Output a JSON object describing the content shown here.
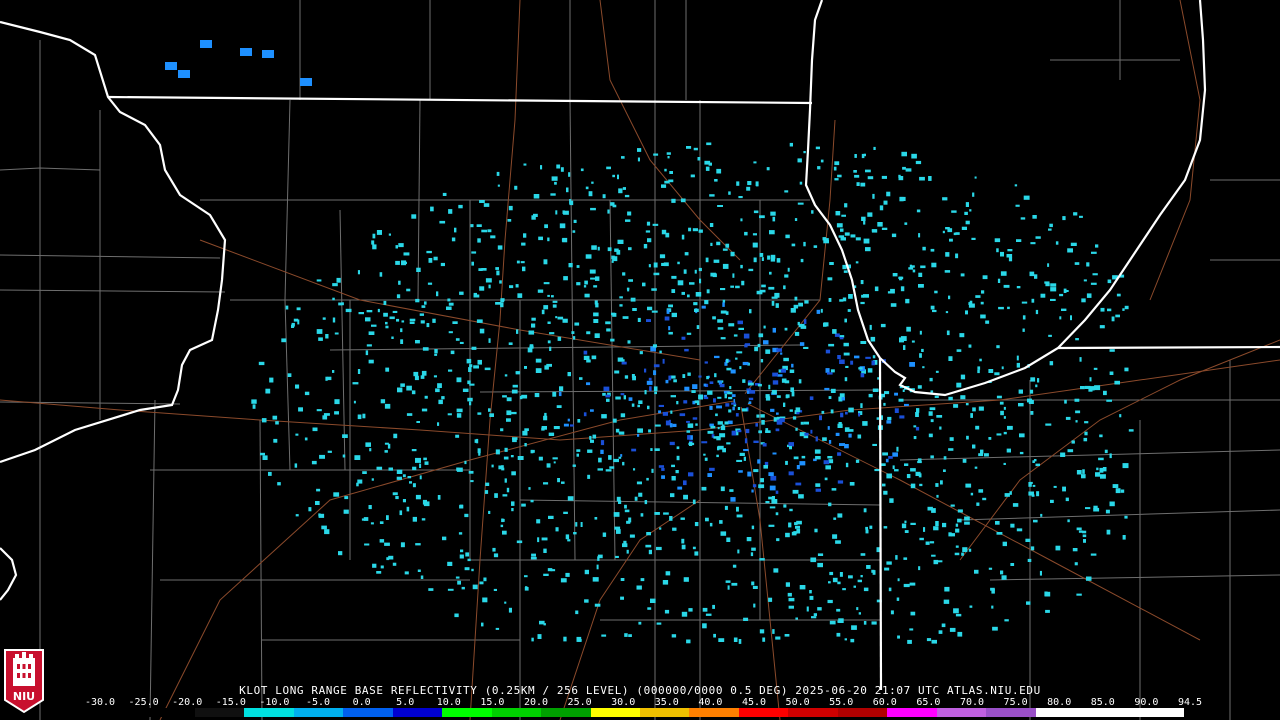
{
  "product": {
    "caption": "KLOT LONG RANGE BASE REFLECTIVITY (0.25KM / 256 LEVEL) (000000/0000 0.5 DEG) 2025-06-20 21:07 UTC  ATLAS.NIU.EDU",
    "station": "KLOT",
    "logo_text": "NIU"
  },
  "scale": {
    "labels": [
      "-30.0",
      "-25.0",
      "-20.0",
      "-15.0",
      "-10.0",
      "-5.0",
      "0.0",
      "5.0",
      "10.0",
      "15.0",
      "20.0",
      "25.0",
      "30.0",
      "35.0",
      "40.0",
      "45.0",
      "50.0",
      "55.0",
      "60.0",
      "65.0",
      "70.0",
      "75.0",
      "80.0",
      "85.0",
      "90.0",
      "94.5"
    ],
    "colors": [
      "#000000",
      "#000000",
      "#000000",
      "#000000",
      "#000000",
      "#1a1a1a",
      "#00e8e8",
      "#0096ff",
      "#0000e0",
      "#00ff00",
      "#00c800",
      "#008c00",
      "#ffff00",
      "#e7c000",
      "#ff9000",
      "#ff0000",
      "#d60000",
      "#c00000",
      "#ff00ff",
      "#9955c9",
      "#ffffff",
      "#ffffff"
    ]
  },
  "colors": {
    "state_border": "#ffffff",
    "county_line": "#7a7a7a",
    "highway": "#8b4a2b",
    "echo_light": "#2ad8e8",
    "echo_medium": "#1e90ff",
    "echo_strong": "#1a4fd8"
  }
}
